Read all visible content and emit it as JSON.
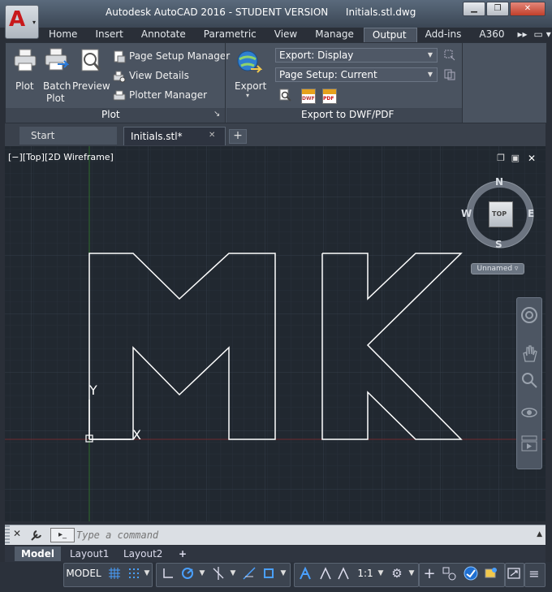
{
  "titlebar": {
    "app_name": "Autodesk AutoCAD 2016 - STUDENT VERSION",
    "file_name": "Initials.stl.dwg",
    "minimize": "▁",
    "restore": "❐",
    "close": "✕"
  },
  "app_menu": {
    "letter": "A",
    "caret": "▾"
  },
  "ribbon_tabs": [
    {
      "label": "Home"
    },
    {
      "label": "Insert"
    },
    {
      "label": "Annotate"
    },
    {
      "label": "Parametric"
    },
    {
      "label": "View"
    },
    {
      "label": "Manage"
    },
    {
      "label": "Output",
      "active": true
    },
    {
      "label": "Add-ins"
    },
    {
      "label": "A360"
    }
  ],
  "ribbon_overflow": "▸▸",
  "ribbon_extra": "▭ ▾",
  "plot_panel": {
    "plot_label": "Plot",
    "batch_plot_label_1": "Batch",
    "batch_plot_label_2": "Plot",
    "preview_label": "Preview",
    "page_setup_manager": "Page Setup Manager",
    "view_details": "View Details",
    "plotter_manager": "Plotter Manager",
    "panel_title": "Plot",
    "launcher": "↘"
  },
  "export_panel": {
    "export_label": "Export",
    "export_caret": "▾",
    "export_dropdown": "Export: Display",
    "page_setup_dropdown": "Page Setup: Current",
    "panel_title": "Export to DWF/PDF",
    "dwf_badge": "DWF",
    "pdf_badge": "PDF"
  },
  "file_tabs": {
    "start": "Start",
    "active_file": "Initials.stl*",
    "close_glyph": "✕",
    "new_tab": "+"
  },
  "viewport": {
    "label": "[−][Top][2D Wireframe]",
    "restore": "❐",
    "maximize": "▣",
    "close": "✕"
  },
  "viewcube": {
    "north": "N",
    "south": "S",
    "east": "E",
    "west": "W",
    "face": "TOP",
    "ucs_menu": "Unnamed ▿"
  },
  "ucs_icon": {
    "y": "Y",
    "x": "X"
  },
  "command_line": {
    "placeholder": "Type a command",
    "prompt_glyph": "▸_",
    "close": "✕"
  },
  "layout_tabs": {
    "model": "Model",
    "layout1": "Layout1",
    "layout2": "Layout2",
    "add": "+"
  },
  "status_bar": {
    "model": "MODEL",
    "scale": "1:1"
  },
  "colors": {
    "viewport_bg": "#212830",
    "geometry": "#ffffff",
    "accent_blue": "#4aa0ff",
    "app_red": "#c8191b"
  }
}
